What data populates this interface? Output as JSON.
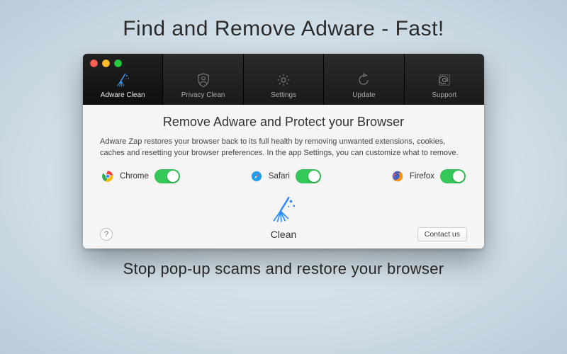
{
  "marketing": {
    "headline": "Find and Remove Adware - Fast!",
    "footline": "Stop pop-up scams and restore your browser"
  },
  "tabs": [
    {
      "id": "adware-clean",
      "label": "Adware Clean",
      "icon": "broom-icon",
      "active": true
    },
    {
      "id": "privacy-clean",
      "label": "Privacy Clean",
      "icon": "shield-user-icon",
      "active": false
    },
    {
      "id": "settings",
      "label": "Settings",
      "icon": "gear-icon",
      "active": false
    },
    {
      "id": "update",
      "label": "Update",
      "icon": "refresh-icon",
      "active": false
    },
    {
      "id": "support",
      "label": "Support",
      "icon": "stamp-at-icon",
      "active": false
    }
  ],
  "panel": {
    "title": "Remove Adware and Protect your Browser",
    "description": "Adware Zap restores your browser back to its full health by removing unwanted extensions, cookies, caches and resetting your browser preferences. In the app Settings, you can customize what to remove."
  },
  "browsers": [
    {
      "name": "Chrome",
      "icon": "chrome-icon",
      "enabled": true
    },
    {
      "name": "Safari",
      "icon": "safari-icon",
      "enabled": true
    },
    {
      "name": "Firefox",
      "icon": "firefox-icon",
      "enabled": true
    }
  ],
  "action": {
    "clean_label": "Clean"
  },
  "footer": {
    "help_glyph": "?",
    "contact_label": "Contact us"
  },
  "colors": {
    "accent": "#2d8cff",
    "toggle_on": "#34c759"
  }
}
